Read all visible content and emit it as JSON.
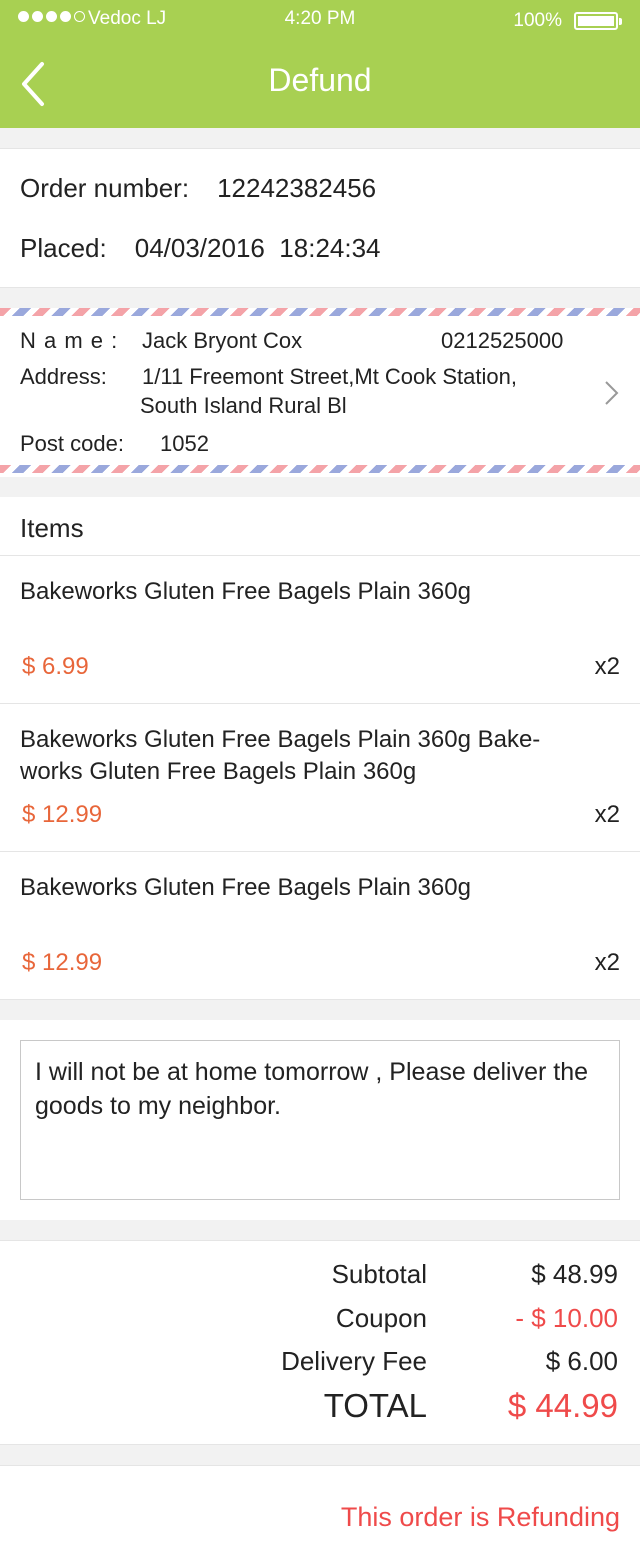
{
  "status_bar": {
    "carrier": "Vedoc LJ",
    "time": "4:20 PM",
    "battery": "100%"
  },
  "header": {
    "title": "Defund",
    "back_icon": "chevron-left-icon"
  },
  "order": {
    "number_label": "Order number:",
    "number": "12242382456",
    "placed_label": "Placed:",
    "placed": "04/03/2016  18:24:34"
  },
  "address": {
    "name_label": "N a m e :",
    "name": "Jack Bryont Cox",
    "phone": "0212525000",
    "address_label": "Address:",
    "address_line1": "1/11 Freemont Street,Mt Cook Station,",
    "address_line2": "South Island Rural Bl",
    "postcode_label": "Post code:",
    "postcode": "1052"
  },
  "items": {
    "heading": "Items",
    "list": [
      {
        "name": "Bakeworks Gluten Free Bagels Plain 360g",
        "price": "$ 6.99",
        "qty": "x2"
      },
      {
        "name": "Bakeworks Gluten Free Bagels Plain 360g Bake-works Gluten Free Bagels Plain 360g",
        "price": "$ 12.99",
        "qty": "x2"
      },
      {
        "name": "Bakeworks Gluten Free Bagels Plain 360g",
        "price": "$ 12.99",
        "qty": "x2"
      }
    ]
  },
  "note": {
    "text": "I will not be at home tomorrow , Please deliver the goods to my neighbor."
  },
  "totals": {
    "subtotal_label": "Subtotal",
    "subtotal": "$ 48.99",
    "coupon_label": "Coupon",
    "coupon": "- $ 10.00",
    "delivery_label": "Delivery Fee",
    "delivery": "$ 6.00",
    "total_label": "TOTAL",
    "total": "$ 44.99"
  },
  "order_status": "This order is Refunding",
  "colors": {
    "header_bg": "#a8d052",
    "price": "#e8663a",
    "alert": "#ef4a4a"
  }
}
